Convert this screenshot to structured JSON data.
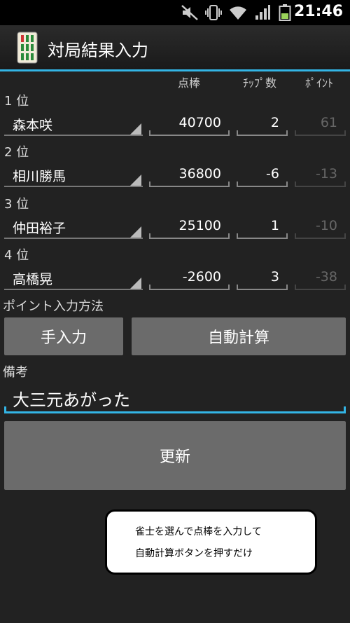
{
  "statusbar": {
    "time": "21:46",
    "icons": [
      "mute-icon",
      "vibrate-icon",
      "wifi-icon",
      "signal-icon",
      "battery-icon"
    ]
  },
  "titlebar": {
    "title": "対局結果入力",
    "icon": "mahjong-tile-icon"
  },
  "columns": {
    "points": "点棒",
    "chips": "ﾁｯﾌﾟ数",
    "score": "ﾎﾟｲﾝﾄ"
  },
  "players": [
    {
      "rank": "1 位",
      "name": "森本咲",
      "points": "40700",
      "chips": "2",
      "score": "61"
    },
    {
      "rank": "2 位",
      "name": "相川勝馬",
      "points": "36800",
      "chips": "-6",
      "score": "-13"
    },
    {
      "rank": "3 位",
      "name": "仲田裕子",
      "points": "25100",
      "chips": "1",
      "score": "-10"
    },
    {
      "rank": "4 位",
      "name": "高橋晃",
      "points": "-2600",
      "chips": "3",
      "score": "-38"
    }
  ],
  "point_method": {
    "label": "ポイント入力方法",
    "manual_button": "手入力",
    "auto_button": "自動計算"
  },
  "remarks": {
    "label": "備考",
    "value": "大三元あがった"
  },
  "update_button": "更新",
  "balloon": {
    "line1": "雀士を選んで点棒を入力して",
    "line2": "自動計算ボタンを押すだけ"
  },
  "colors": {
    "accent": "#33b5e5",
    "button": "#6b6b6b",
    "background": "#222222"
  }
}
